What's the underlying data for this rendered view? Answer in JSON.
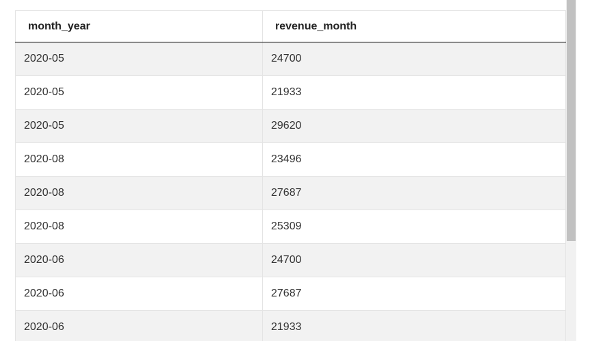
{
  "table": {
    "columns": [
      "month_year",
      "revenue_month"
    ],
    "rows": [
      [
        "2020-05",
        "24700"
      ],
      [
        "2020-05",
        "21933"
      ],
      [
        "2020-05",
        "29620"
      ],
      [
        "2020-08",
        "23496"
      ],
      [
        "2020-08",
        "27687"
      ],
      [
        "2020-08",
        "25309"
      ],
      [
        "2020-06",
        "24700"
      ],
      [
        "2020-06",
        "27687"
      ],
      [
        "2020-06",
        "21933"
      ]
    ]
  },
  "colors": {
    "header_border": "#000000",
    "row_stripe": "#f2f2f2",
    "scrollbar_thumb": "#c1c1c1"
  }
}
